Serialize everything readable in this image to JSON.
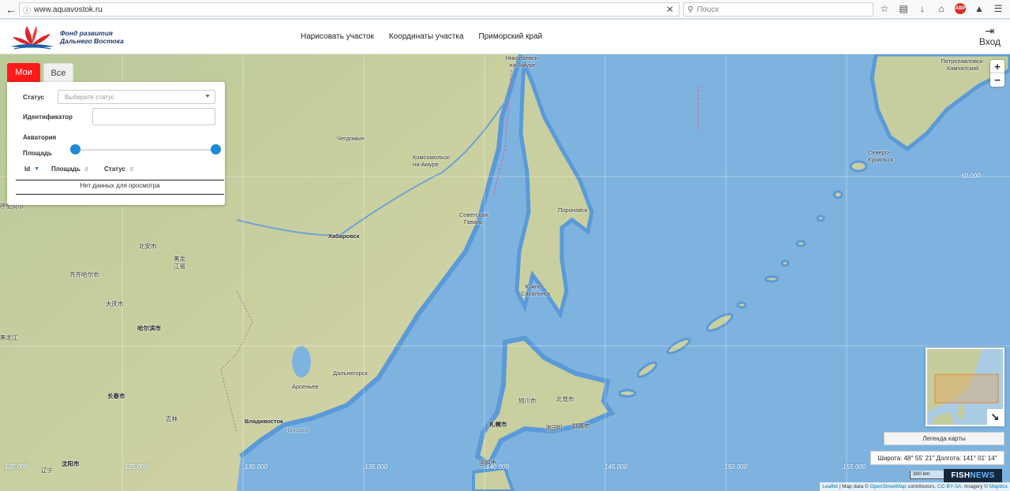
{
  "browser": {
    "url": "www.aquavostok.ru",
    "search_placeholder": "Поиск"
  },
  "header": {
    "logo_line1": "Фонд развития",
    "logo_line2": "Дальнего Востока",
    "nav": [
      "Нарисовать участок",
      "Координаты участка",
      "Приморский край"
    ],
    "login_label": "Вход"
  },
  "panel": {
    "tabs": {
      "mine": "Мои",
      "all": "Все"
    },
    "status_label": "Статус",
    "status_placeholder": "Выберите статус",
    "id_label": "Идентификатор",
    "water_area_label": "Акватория",
    "area_label": "Площадь",
    "area_slider": {
      "low": 0,
      "high": 1
    },
    "table_headers": [
      "Id",
      "Площадь",
      "Статус"
    ],
    "empty_text": "Нет данных для просмотра"
  },
  "map": {
    "labels": [
      "Николаевск-на-Амуре",
      "Петропавловск-Камчатский",
      "Чегдомын",
      "Комсомольск-на-Амуре",
      "Северо-Курильск",
      "Советская Гавань",
      "Поронайск",
      "Хабаровск",
      "北安市",
      "黑龙江省",
      "齐齐哈尔市",
      "大庆市",
      "Южно-Сахалинск",
      "哈尔滨市",
      "Дальнегорск",
      "Арсеньев",
      "长春市",
      "吉林",
      "Владивосток",
      "Находка",
      "旭川市",
      "北見市",
      "札幌市",
      "池田町",
      "釧路市",
      "沈阳市",
      "辽宁",
      "函館市",
      "呼伦贝尔",
      "黑龙江"
    ],
    "lon_ticks": [
      "120.000",
      "125.000",
      "130.000",
      "135.000",
      "140.000",
      "145.000",
      "150.000",
      "155.000"
    ],
    "lat_tick": "50.000",
    "zoom_in": "+",
    "zoom_out": "−",
    "legend_button": "Легенда карты",
    "coordinates": "Широта: 48° 55' 21\" Долгота: 141° 01' 14\"",
    "scale": "300 km",
    "attribution": {
      "leaflet": "Leaflet",
      "map_data": "Map data ©",
      "osm": "OpenStreetMap",
      "contributors": "contributors,",
      "license": "CC-BY-SA",
      "imagery": ", Imagery ©",
      "mapbox": "Mapbox"
    },
    "watermark_a": "FISH",
    "watermark_b": "NEWS"
  }
}
